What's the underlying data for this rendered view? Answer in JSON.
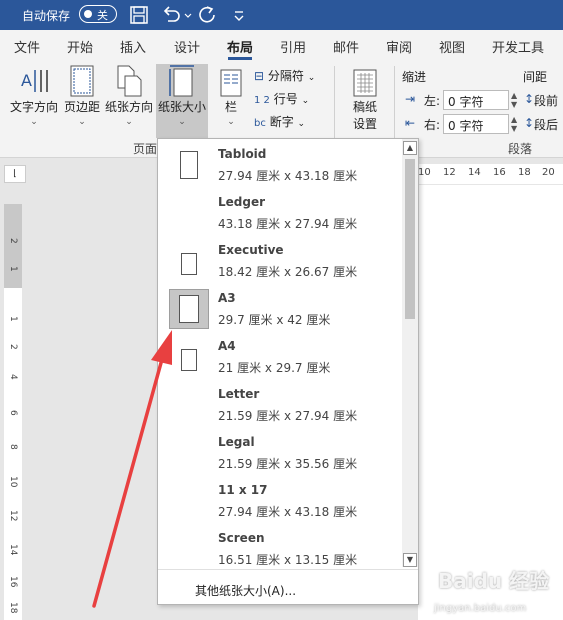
{
  "titlebar": {
    "autosave_label": "自动保存",
    "autosave_state": "关",
    "icons": [
      "save-icon",
      "undo-icon",
      "redo-icon",
      "customize-icon"
    ]
  },
  "tabs": [
    "文件",
    "开始",
    "插入",
    "设计",
    "布局",
    "引用",
    "邮件",
    "审阅",
    "视图",
    "开发工具"
  ],
  "active_tab": "布局",
  "ribbon": {
    "text_direction": "文字方向",
    "margins": "页边距",
    "orientation": "纸张方向",
    "size": "纸张大小",
    "columns": "栏",
    "breaks": "分隔符",
    "line_numbers": "行号",
    "hyphenation": "断字",
    "manuscript_line1": "稿纸",
    "manuscript_line2": "设置",
    "page_group_label": "页面",
    "indent_label": "缩进",
    "indent_left_label": "左:",
    "indent_left_value": "0 字符",
    "indent_right_label": "右:",
    "indent_right_value": "0 字符",
    "spacing_label": "间距",
    "before_label": "段前",
    "after_label": "段后",
    "paragraph_group_label": "段落"
  },
  "ruler_ticks": [
    "10",
    "12",
    "14",
    "16",
    "18",
    "20"
  ],
  "vruler_ticks": [
    "2",
    "1",
    "1",
    "2",
    "4",
    "6",
    "8",
    "10",
    "12",
    "14",
    "16",
    "18"
  ],
  "paper_sizes": [
    {
      "name": "Tabloid",
      "dims": "27.94 厘米 x 43.18 厘米",
      "thumb_w": 18,
      "thumb_h": 28,
      "selected": false
    },
    {
      "name": "Ledger",
      "dims": "43.18 厘米 x 27.94 厘米",
      "thumb_w": 0,
      "thumb_h": 0,
      "selected": false
    },
    {
      "name": "Executive",
      "dims": "18.42 厘米 x 26.67 厘米",
      "thumb_w": 16,
      "thumb_h": 22,
      "selected": false
    },
    {
      "name": "A3",
      "dims": "29.7 厘米 x 42 厘米",
      "thumb_w": 20,
      "thumb_h": 28,
      "selected": true
    },
    {
      "name": "A4",
      "dims": "21 厘米 x 29.7 厘米",
      "thumb_w": 16,
      "thumb_h": 22,
      "selected": false
    },
    {
      "name": "Letter",
      "dims": "21.59 厘米 x 27.94 厘米",
      "thumb_w": 0,
      "thumb_h": 0,
      "selected": false
    },
    {
      "name": "Legal",
      "dims": "21.59 厘米 x 35.56 厘米",
      "thumb_w": 0,
      "thumb_h": 0,
      "selected": false
    },
    {
      "name": "11 x 17",
      "dims": "27.94 厘米 x 43.18 厘米",
      "thumb_w": 0,
      "thumb_h": 0,
      "selected": false
    },
    {
      "name": "Screen",
      "dims": "16.51 厘米 x 13.15 厘米",
      "thumb_w": 0,
      "thumb_h": 0,
      "selected": false
    }
  ],
  "more_sizes": "其他纸张大小(A)...",
  "watermark": {
    "main": "Baidu 经验",
    "sub": "jingyan.baidu.com"
  },
  "colors": {
    "titlebar": "#2b579a",
    "arrow": "#e84040",
    "selected_bg": "#c6c6c6"
  }
}
